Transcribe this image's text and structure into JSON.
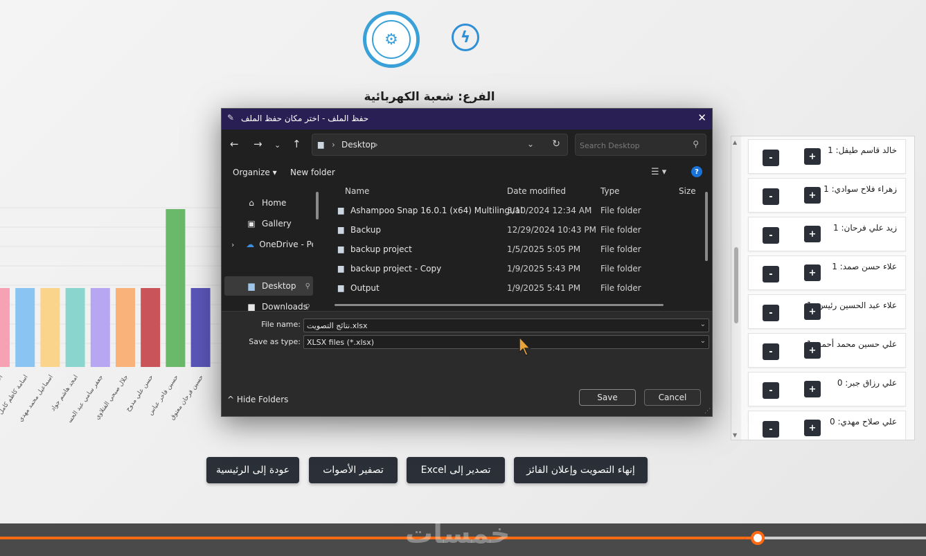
{
  "header": {
    "branch_title": "الفرع: شعبة الكهربائية",
    "logo_union_icon": "union-seal-icon",
    "logo_bolt_icon": "lightning-bolt-icon"
  },
  "chart_data": {
    "type": "bar",
    "categories": [
      "احمد كاظم جبار",
      "اسامة كاظم كامل",
      "اسماعيل محمد مهدي",
      "امجد هاشم جواد",
      "جعفر سامي عبد الحسين",
      "جلال صبحي الفتلاوي",
      "حسن علي مدوح",
      "حسين فاخر عباس",
      "حسين فرحان معتوق"
    ],
    "values": [
      1,
      1,
      1,
      1,
      1,
      1,
      1,
      2,
      1
    ],
    "colors": [
      "#f7a1b5",
      "#89c4f2",
      "#fad48a",
      "#8ad6cf",
      "#b7a6f2",
      "#f8b27a",
      "#c9555a",
      "#6ab86a",
      "#5a56b8"
    ]
  },
  "candidates": [
    {
      "name": "خالد قاسم طيفل: 1"
    },
    {
      "name": "زهراء فلاح سوادي: 1"
    },
    {
      "name": "زيد علي فرحان: 1"
    },
    {
      "name": "علاء حسن صمد: 1"
    },
    {
      "name": "علاء عبد الحسين رئيس: 1"
    },
    {
      "name": "علي حسين محمد أحمد: 1"
    },
    {
      "name": "علي رزاق جبر: 0"
    },
    {
      "name": "علي صلاح مهدي: 0"
    }
  ],
  "candidate_buttons": {
    "plus": "+",
    "minus": "-"
  },
  "actions": {
    "finish": "إنهاء التصويت وإعلان الفائز",
    "export": "تصدير إلى Excel",
    "reset": "تصفير الأصوات",
    "home": "عودة إلى الرئيسية"
  },
  "dialog": {
    "title": "حفظ الملف - اختر مكان حفظ الملف",
    "close": "✕",
    "address": "Desktop",
    "search_placeholder": "Search Desktop",
    "organize": "Organize ▾",
    "new_folder": "New folder",
    "nav_items": [
      {
        "label": "Home",
        "icon": "home-icon"
      },
      {
        "label": "Gallery",
        "icon": "gallery-icon"
      },
      {
        "label": "OneDrive - Pers",
        "icon": "cloud-icon"
      },
      {
        "label": "Desktop",
        "icon": "desktop-icon"
      },
      {
        "label": "Downloads",
        "icon": "download-icon"
      }
    ],
    "columns": {
      "name": "Name",
      "date": "Date modified",
      "type": "Type",
      "size": "Size"
    },
    "files": [
      {
        "name": "Ashampoo Snap 16.0.1 (x64) Multilingual",
        "date": "3/10/2024 12:34 AM",
        "type": "File folder"
      },
      {
        "name": "Backup",
        "date": "12/29/2024 10:43 PM",
        "type": "File folder"
      },
      {
        "name": "backup project",
        "date": "1/5/2025 5:05 PM",
        "type": "File folder"
      },
      {
        "name": "backup project - Copy",
        "date": "1/9/2025 5:43 PM",
        "type": "File folder"
      },
      {
        "name": "Output",
        "date": "1/9/2025 5:41 PM",
        "type": "File folder"
      }
    ],
    "file_name_label": "File name:",
    "file_name_value": "نتائج التصويت.xlsx",
    "save_type_label": "Save as type:",
    "save_type_value": "XLSX files (*.xlsx)",
    "hide_folders": "^ Hide Folders",
    "save": "Save",
    "cancel": "Cancel"
  },
  "video": {
    "progress": 0.818,
    "watermark": "خمسات"
  }
}
